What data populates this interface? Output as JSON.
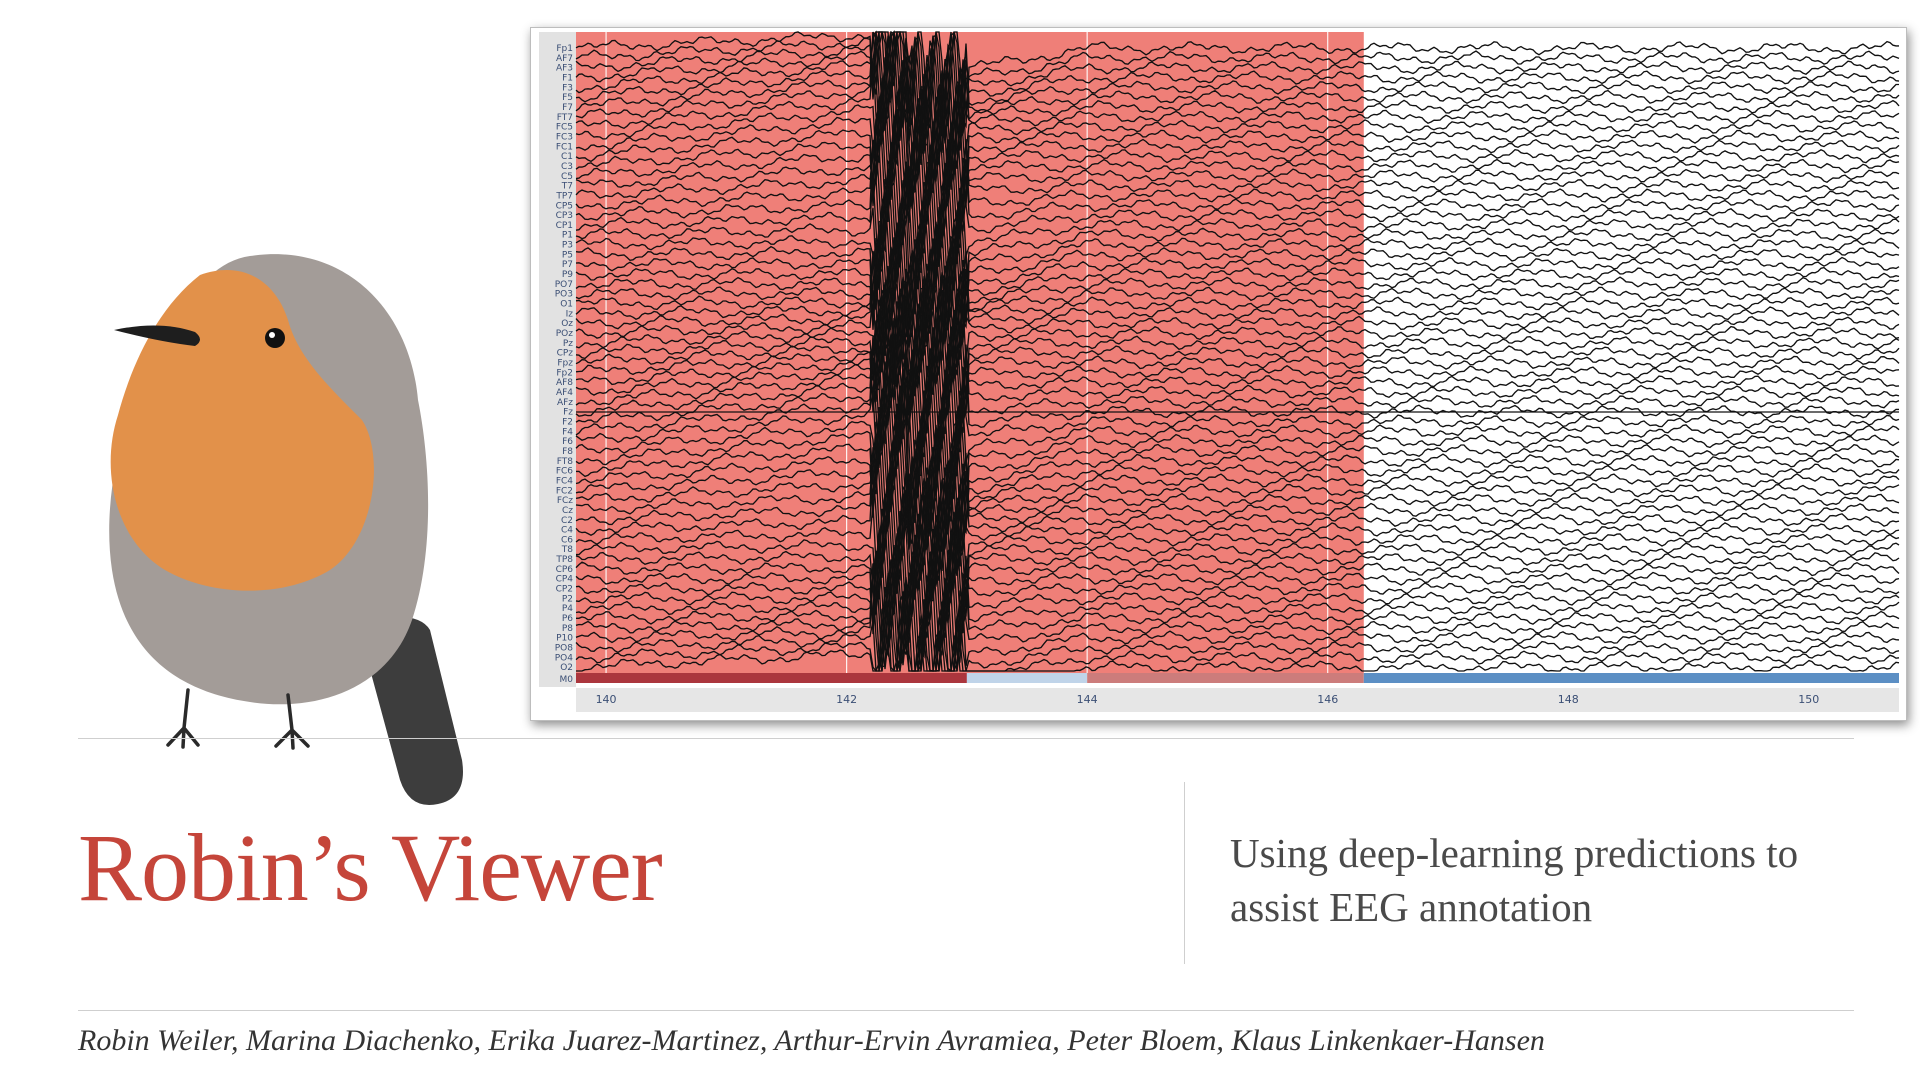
{
  "title": "Robin’s Viewer",
  "subtitle": "Using deep-learning predictions to assist EEG annotation",
  "authors": "Robin Weiler, Marina Diachenko, Erika Juarez-Martinez, Arthur-Ervin Avramiea, Peter Bloem, Klaus Linkenkaer-Hansen",
  "colors": {
    "title": "#c5453a",
    "annotation_fill": "#ef7f78",
    "robin_breast": "#e2914a",
    "robin_body": "#a39c98",
    "robin_tail": "#3d3d3d",
    "prediction_high": "#a3252e",
    "prediction_low": "#3b78b8"
  },
  "icons": {
    "mascot": "robin-bird-illustration"
  },
  "chart_data": {
    "type": "line",
    "description_source": "EEG multi-channel viewer",
    "channels": [
      "Fp1",
      "AF7",
      "AF3",
      "F1",
      "F3",
      "F5",
      "F7",
      "FT7",
      "FC5",
      "FC3",
      "FC1",
      "C1",
      "C3",
      "C5",
      "T7",
      "TP7",
      "CP5",
      "CP3",
      "CP1",
      "P1",
      "P3",
      "P5",
      "P7",
      "P9",
      "PO7",
      "PO3",
      "O1",
      "Iz",
      "Oz",
      "POz",
      "Pz",
      "CPz",
      "Fpz",
      "Fp2",
      "AF8",
      "AF4",
      "AFz",
      "Fz",
      "F2",
      "F4",
      "F6",
      "F8",
      "FT8",
      "FC6",
      "FC4",
      "FC2",
      "FCz",
      "Cz",
      "C2",
      "C4",
      "C6",
      "T8",
      "TP8",
      "CP6",
      "CP4",
      "CP2",
      "P2",
      "P4",
      "P6",
      "P8",
      "P10",
      "PO8",
      "PO4",
      "O2"
    ],
    "prediction_channel": "M0",
    "x_ticks": [
      140,
      142,
      144,
      146,
      148,
      150
    ],
    "xlim": [
      139.75,
      150.75
    ],
    "annotation": {
      "x_start": 139.75,
      "x_end": 146.3,
      "label": ""
    },
    "artifact_events": [
      142.2,
      142.5,
      143.0
    ],
    "prediction_segments": [
      {
        "x_start": 139.75,
        "x_end": 143.0,
        "score": 0.95
      },
      {
        "x_start": 143.0,
        "x_end": 144.0,
        "score": 0.4
      },
      {
        "x_start": 144.0,
        "x_end": 146.3,
        "score": 0.75
      },
      {
        "x_start": 146.3,
        "x_end": 150.75,
        "score": 0.1
      }
    ],
    "grid": true
  }
}
